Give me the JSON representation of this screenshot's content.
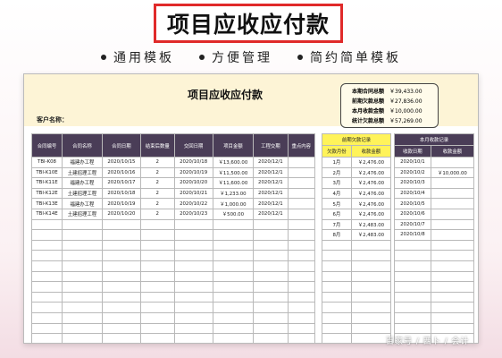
{
  "banner_title": "项目应收应付款",
  "features": [
    "通用模板",
    "方便管理",
    "简约简单模板"
  ],
  "sheet": {
    "title": "项目应收应付款",
    "client_label": "客户名称：",
    "summary": [
      {
        "label": "本期合同总额",
        "value": "￥39,433.00"
      },
      {
        "label": "前期欠款总额",
        "value": "￥27,836.00"
      },
      {
        "label": "本月收款金额",
        "value": "￥10,000.00"
      },
      {
        "label": "统计欠款总额",
        "value": "￥57,269.00"
      }
    ]
  },
  "main_table": {
    "headers": [
      "合同编号",
      "合同名称",
      "合同日期",
      "结束后数量",
      "交回日期",
      "项目金额",
      "工程交期",
      "重点内容"
    ],
    "rows": [
      [
        "TBI-K08",
        "福建办工程",
        "2020/10/15",
        "2",
        "2020/10/18",
        "￥13,600.00",
        "2020/12/1",
        ""
      ],
      [
        "TBI-K10E",
        "土建招理工程",
        "2020/10/16",
        "2",
        "2020/10/19",
        "￥11,500.00",
        "2020/12/1",
        ""
      ],
      [
        "TBI-K11E",
        "福建办工程",
        "2020/10/17",
        "2",
        "2020/10/20",
        "￥11,600.00",
        "2020/12/1",
        ""
      ],
      [
        "TBI-K12E",
        "土建招理工程",
        "2020/10/18",
        "2",
        "2020/10/21",
        "￥1,233.00",
        "2020/12/1",
        ""
      ],
      [
        "TBI-K13E",
        "福建办工程",
        "2020/10/19",
        "2",
        "2020/10/22",
        "￥1,000.00",
        "2020/12/1",
        ""
      ],
      [
        "TBI-K14E",
        "土建招理工程",
        "2020/10/20",
        "2",
        "2020/10/23",
        "￥500.00",
        "2020/12/1",
        ""
      ]
    ],
    "empty_rows": 13
  },
  "arrears_table": {
    "title": "前期欠款记录",
    "headers": [
      "欠款月份",
      "收款金额"
    ],
    "rows": [
      [
        "1月",
        "￥2,476.00"
      ],
      [
        "2月",
        "￥2,476.00"
      ],
      [
        "3月",
        "￥2,476.00"
      ],
      [
        "4月",
        "￥2,476.00"
      ],
      [
        "5月",
        "￥2,476.00"
      ],
      [
        "6月",
        "￥2,476.00"
      ],
      [
        "7月",
        "￥2,483.00"
      ],
      [
        "8月",
        "￥2,483.00"
      ]
    ],
    "empty_rows": 11
  },
  "monthly_table": {
    "title": "本月收款记录",
    "headers": [
      "收款日期",
      "收款金额"
    ],
    "rows": [
      [
        "2020/10/1",
        ""
      ],
      [
        "2020/10/2",
        "￥10,000.00"
      ],
      [
        "2020/10/3",
        ""
      ],
      [
        "2020/10/4",
        ""
      ],
      [
        "2020/10/5",
        ""
      ],
      [
        "2020/10/6",
        ""
      ],
      [
        "2020/10/7",
        ""
      ],
      [
        "2020/10/8",
        ""
      ]
    ],
    "empty_rows": 11
  },
  "watermark": "百家号 / 西卜 / 会计"
}
